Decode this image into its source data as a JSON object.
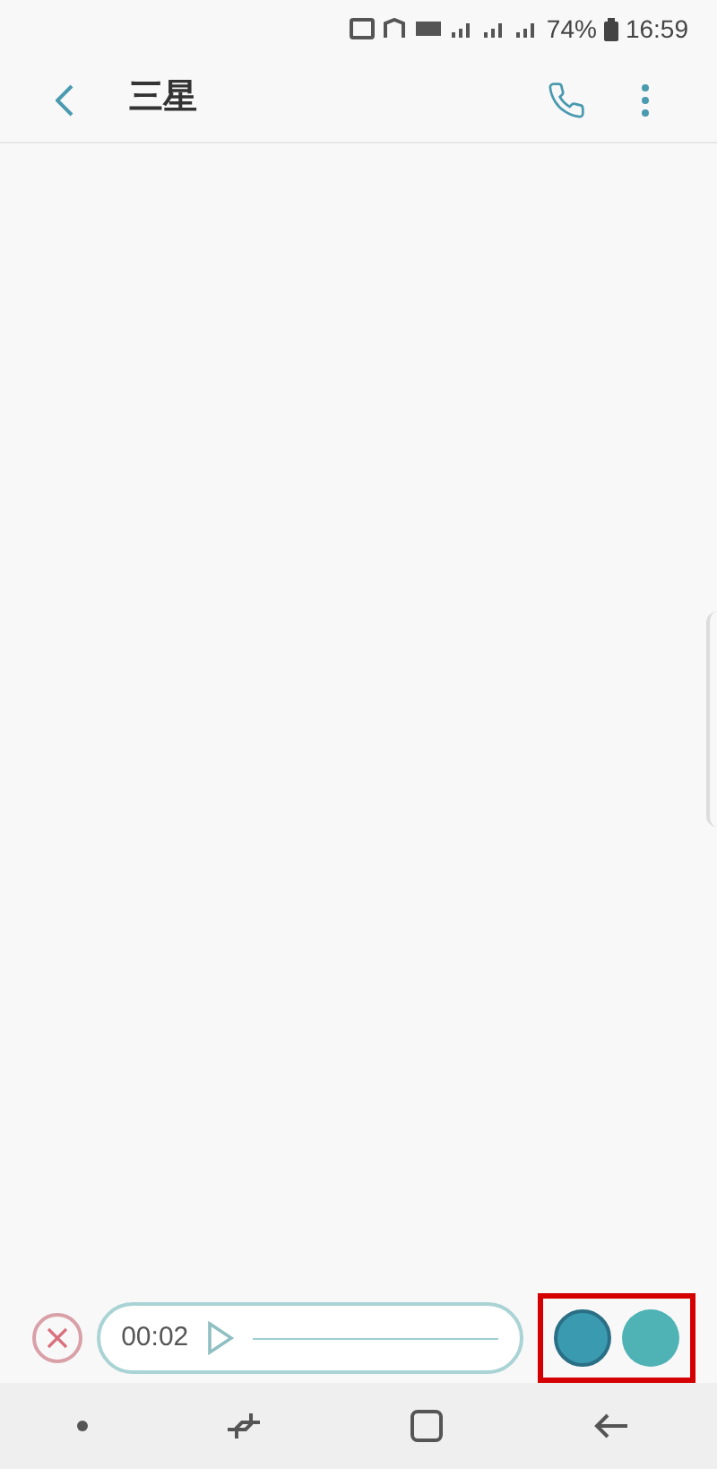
{
  "status_bar": {
    "battery": "74%",
    "time": "16:59"
  },
  "header": {
    "title": "三星"
  },
  "recorder": {
    "duration": "00:02"
  },
  "send_buttons": {
    "highlighted": true
  }
}
